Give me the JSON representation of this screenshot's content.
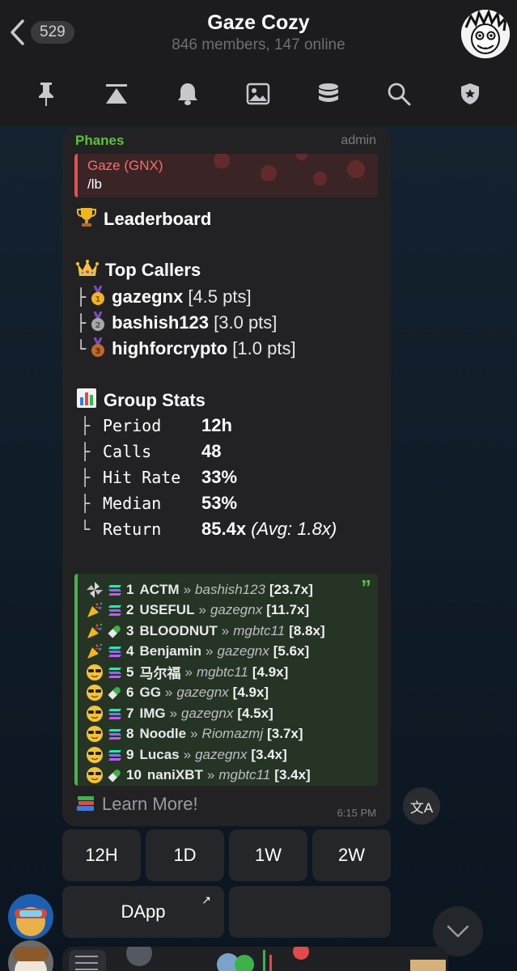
{
  "header": {
    "back_count": "529",
    "title": "Gaze Cozy",
    "subtitle": "846 members, 147 online",
    "toolbar_icons": [
      "pin-icon",
      "scroll-top-icon",
      "bell-icon",
      "image-icon",
      "database-icon",
      "search-icon",
      "shield-icon"
    ]
  },
  "message": {
    "sender": "Phanes",
    "role": "admin",
    "reply": {
      "name": "Gaze (GNX)",
      "text": "/lb"
    },
    "leaderboard_title": "Leaderboard",
    "callers_title": "Top Callers",
    "callers": [
      {
        "name": "gazegnx",
        "pts": "[4.5 pts]",
        "medal": "1"
      },
      {
        "name": "bashish123",
        "pts": "[3.0 pts]",
        "medal": "2"
      },
      {
        "name": "highforcrypto",
        "pts": "[1.0 pts]",
        "medal": "3"
      }
    ],
    "stats_title": "Group Stats",
    "stats": [
      {
        "label": "Period",
        "value": "12h"
      },
      {
        "label": "Calls",
        "value": "48"
      },
      {
        "label": "Hit Rate",
        "value": "33%"
      },
      {
        "label": "Median",
        "value": "53%"
      },
      {
        "label": "Return",
        "value": "85.4x",
        "extra": "(Avg: 1.8x)"
      }
    ],
    "calls": [
      {
        "num": "1",
        "token": "ACTM",
        "user": "bashish123",
        "mult": "[23.7x]",
        "icon": "pinwheel-icon",
        "chain": "solana-icon"
      },
      {
        "num": "2",
        "token": "USEFUL",
        "user": "gazegnx",
        "mult": "[11.7x]",
        "icon": "party-popper-icon",
        "chain": "solana-icon"
      },
      {
        "num": "3",
        "token": "BLOODNUT",
        "user": "mgbtc11",
        "mult": "[8.8x]",
        "icon": "party-popper-icon",
        "chain": "pill-icon"
      },
      {
        "num": "4",
        "token": "Benjamin",
        "user": "gazegnx",
        "mult": "[5.6x]",
        "icon": "party-popper-icon",
        "chain": "solana-icon"
      },
      {
        "num": "5",
        "token": "马尔福",
        "user": "mgbtc11",
        "mult": "[4.9x]",
        "icon": "sunglasses-icon",
        "chain": "solana-icon"
      },
      {
        "num": "6",
        "token": "GG",
        "user": "gazegnx",
        "mult": "[4.9x]",
        "icon": "sunglasses-icon",
        "chain": "pill-icon"
      },
      {
        "num": "7",
        "token": "IMG",
        "user": "gazegnx",
        "mult": "[4.5x]",
        "icon": "sunglasses-icon",
        "chain": "solana-icon"
      },
      {
        "num": "8",
        "token": "Noodle",
        "user": "Riomazmj",
        "mult": "[3.7x]",
        "icon": "sunglasses-icon",
        "chain": "solana-icon"
      },
      {
        "num": "9",
        "token": "Lucas",
        "user": "gazegnx",
        "mult": "[3.4x]",
        "icon": "sunglasses-icon",
        "chain": "solana-icon"
      },
      {
        "num": "10",
        "token": "naniXBT",
        "user": "mgbtc11",
        "mult": "[3.4x]",
        "icon": "sunglasses-icon",
        "chain": "pill-icon"
      }
    ],
    "separator": "»",
    "learn_more": "Learn More!",
    "time": "6:15 PM"
  },
  "keyboard": {
    "row1": [
      "12H",
      "1D",
      "1W",
      "2W"
    ],
    "dapp": "DApp",
    "dapp_arrow": "↗"
  },
  "translate_glyph": "文A"
}
